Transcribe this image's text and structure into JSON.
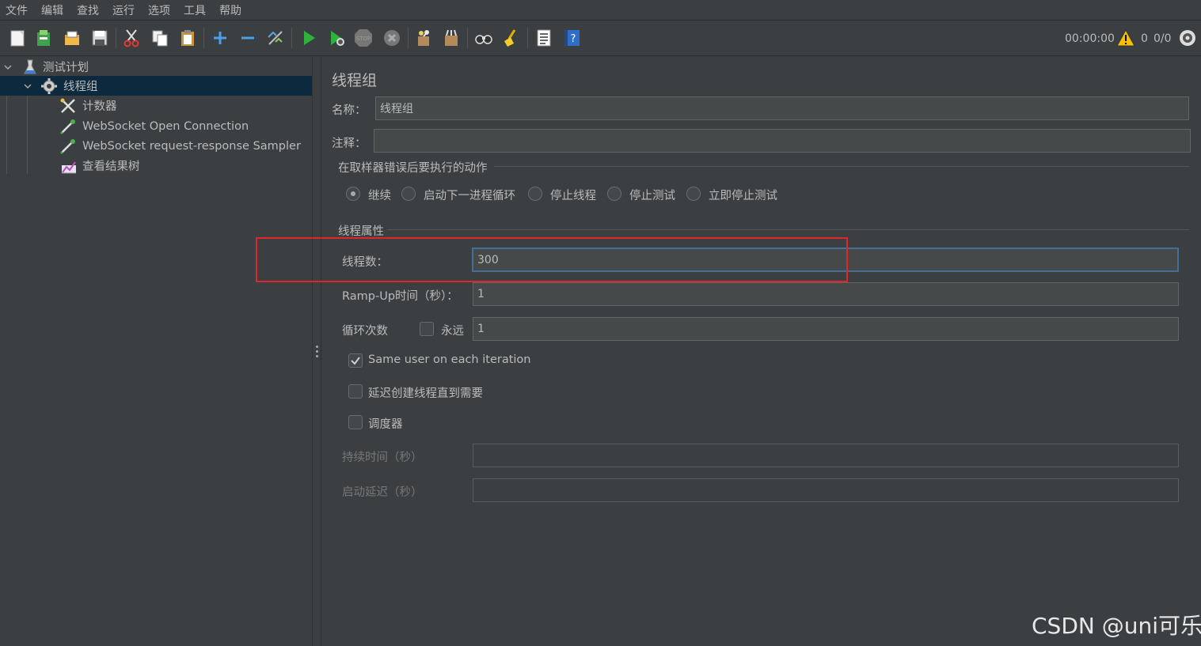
{
  "menu": [
    "文件",
    "编辑",
    "查找",
    "运行",
    "选项",
    "工具",
    "帮助"
  ],
  "toolbar": {
    "icons": [
      "new-icon",
      "templates-icon",
      "open-icon",
      "save-icon",
      "cut-icon",
      "copy-icon",
      "paste-icon",
      "expand-icon",
      "collapse-icon",
      "toggle-icon",
      "start-icon",
      "start-no-pause-icon",
      "stop-icon",
      "shutdown-icon",
      "clear-icon",
      "clear-all-icon",
      "search-icon",
      "reset-search-icon",
      "function-helper-icon",
      "help-icon"
    ],
    "elapsed": "00:00:00",
    "warning_count": "0",
    "thread_count": "0/0",
    "warning_color": "#f5c000"
  },
  "tree": {
    "items": [
      {
        "label": "测试计划",
        "icon": "test-plan-icon"
      },
      {
        "label": "线程组",
        "icon": "thread-group-gear-icon"
      },
      {
        "label": "计数器",
        "icon": "counter-tools-icon"
      },
      {
        "label": "WebSocket Open Connection",
        "icon": "sampler-pipette-icon"
      },
      {
        "label": "WebSocket request-response Sampler",
        "icon": "sampler-pipette-icon"
      },
      {
        "label": "查看结果树",
        "icon": "listener-chart-icon"
      }
    ],
    "selected_color": "#0d293e"
  },
  "panel": {
    "title": "线程组",
    "name_label": "名称：",
    "name_value": "线程组",
    "comment_label": "注释：",
    "comment_value": "",
    "error_section": "在取样器错误后要执行的动作",
    "error_actions": [
      "继续",
      "启动下一进程循环",
      "停止线程",
      "停止测试",
      "立即停止测试"
    ],
    "error_action_selected": "继续",
    "thread_section": "线程属性",
    "threads_label": "线程数：",
    "threads_value": "300",
    "rampup_label": "Ramp-Up时间（秒）：",
    "rampup_value": "1",
    "loop_label": "循环次数",
    "forever_label": "永远",
    "forever_checked": false,
    "loop_value": "1",
    "same_user_label": "Same user on each iteration",
    "same_user_checked": true,
    "delay_label": "延迟创建线程直到需要",
    "delay_checked": false,
    "scheduler_label": "调度器",
    "scheduler_checked": false,
    "duration_label": "持续时间（秒）",
    "duration_value": "",
    "startup_delay_label": "启动延迟（秒）",
    "startup_delay_value": ""
  },
  "highlight_color": "#e0262a",
  "watermark": "CSDN @uni可乐"
}
